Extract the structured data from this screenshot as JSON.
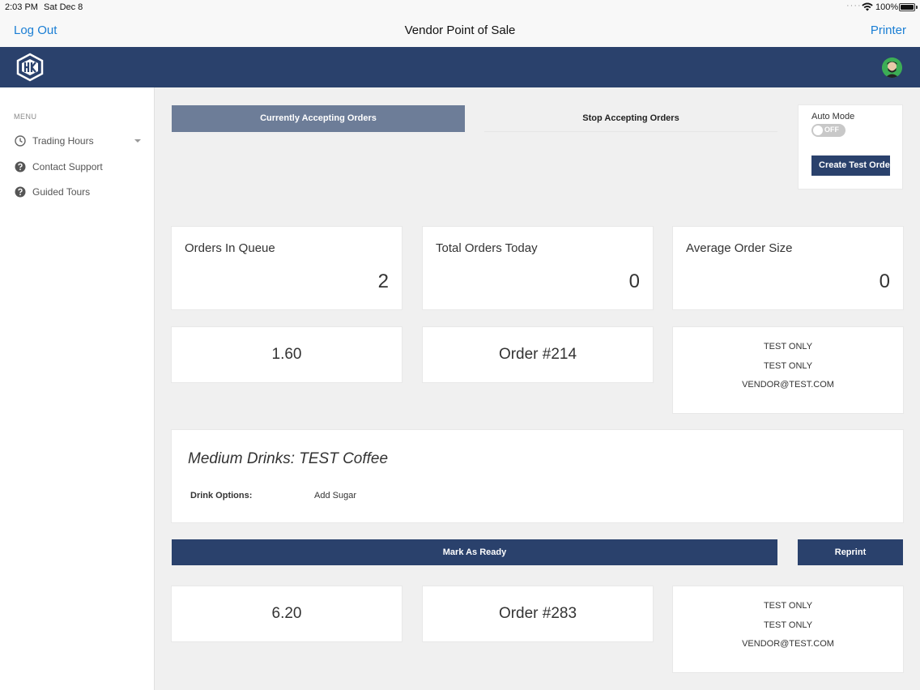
{
  "status_bar": {
    "time": "2:03 PM",
    "date": "Sat Dec 8",
    "battery": "100%"
  },
  "navbar": {
    "left": "Log Out",
    "title": "Vendor Point of Sale",
    "right": "Printer"
  },
  "sidebar": {
    "menu_label": "MENU",
    "items": [
      {
        "label": "Trading Hours",
        "icon": "clock-icon"
      },
      {
        "label": "Contact Support",
        "icon": "help-icon"
      },
      {
        "label": "Guided Tours",
        "icon": "help-icon"
      }
    ]
  },
  "controls": {
    "accepting": "Currently Accepting Orders",
    "stop": "Stop Accepting Orders",
    "auto_mode_label": "Auto Mode",
    "auto_mode_state": "OFF",
    "create_test": "Create Test Order"
  },
  "stats": [
    {
      "label": "Orders In Queue",
      "value": "2"
    },
    {
      "label": "Total Orders Today",
      "value": "0"
    },
    {
      "label": "Average Order Size",
      "value": "0"
    }
  ],
  "orders": [
    {
      "total": "1.60",
      "number": "Order #214",
      "customer": [
        "TEST ONLY",
        "TEST ONLY",
        "VENDOR@TEST.COM"
      ],
      "item_title": "Medium Drinks: TEST Coffee",
      "option_label": "Drink Options:",
      "option_value": "Add Sugar"
    },
    {
      "total": "6.20",
      "number": "Order #283",
      "customer": [
        "TEST ONLY",
        "TEST ONLY",
        "VENDOR@TEST.COM"
      ]
    }
  ],
  "actions": {
    "ready": "Mark As Ready",
    "reprint": "Reprint"
  },
  "colors": {
    "brand": "#2a416c",
    "accepting": "#6d7d98",
    "link": "#1a7ed4"
  }
}
